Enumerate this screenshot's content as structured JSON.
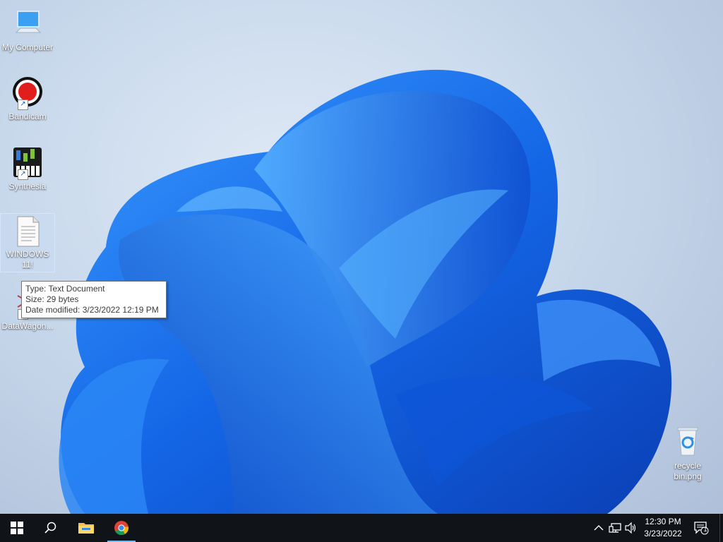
{
  "desktop": {
    "icons": [
      {
        "label": "My Computer",
        "icon": "computer-icon"
      },
      {
        "label": "Bandicam",
        "icon": "bandicam-icon"
      },
      {
        "label": "Synthesia",
        "icon": "synthesia-icon"
      },
      {
        "label": "WINDOWS 11!",
        "icon": "text-document-icon"
      },
      {
        "label": "DataWagon...",
        "icon": "datawagon-icon"
      },
      {
        "label": "recycle bin.png",
        "icon": "recycle-bin-icon"
      }
    ],
    "tooltip": {
      "type": "Type: Text Document",
      "size": "Size: 29 bytes",
      "modified": "Date modified: 3/23/2022 12:19 PM"
    }
  },
  "taskbar": {
    "start": "windows-start-icon",
    "search": "search-icon",
    "pinned": [
      "file-explorer-icon",
      "chrome-icon"
    ],
    "tray": {
      "chevron": "chevron-up-icon",
      "network": "network-icon",
      "volume": "volume-icon",
      "time": "12:30 PM",
      "date": "3/23/2022",
      "notifications": "1"
    }
  },
  "colors": {
    "taskbar": "#101317",
    "wallpaper_blue": "#1a6fe8",
    "accent": "#76b9ed"
  }
}
